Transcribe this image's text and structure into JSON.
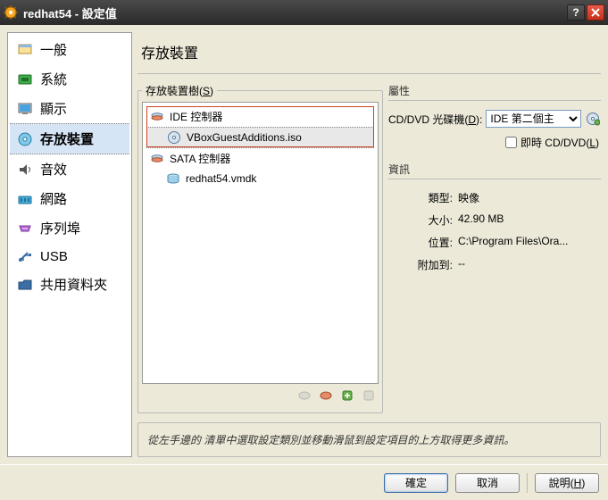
{
  "window": {
    "title": "redhat54 - 設定值"
  },
  "sidebar": {
    "items": [
      {
        "label": "一般",
        "icon": "general"
      },
      {
        "label": "系統",
        "icon": "system"
      },
      {
        "label": "顯示",
        "icon": "display"
      },
      {
        "label": "存放裝置",
        "icon": "storage",
        "selected": true
      },
      {
        "label": "音效",
        "icon": "audio"
      },
      {
        "label": "網路",
        "icon": "network"
      },
      {
        "label": "序列埠",
        "icon": "serial"
      },
      {
        "label": "USB",
        "icon": "usb"
      },
      {
        "label": "共用資料夾",
        "icon": "shared"
      }
    ]
  },
  "main": {
    "title": "存放裝置"
  },
  "tree": {
    "legend": "存放裝置樹",
    "legend_accel": "S",
    "items": [
      {
        "label": "IDE 控制器",
        "icon": "ide-controller",
        "level": 0
      },
      {
        "label": "VBoxGuestAdditions.iso",
        "icon": "cd",
        "level": 1,
        "selected": true
      },
      {
        "label": "SATA 控制器",
        "icon": "sata-controller",
        "level": 0
      },
      {
        "label": "redhat54.vmdk",
        "icon": "hdd",
        "level": 1
      }
    ]
  },
  "attrs": {
    "head": "屬性",
    "drive_label": "CD/DVD 光碟機",
    "drive_accel": "D",
    "drive_value": "IDE 第二個主",
    "live_label": "即時 CD/DVD",
    "live_accel": "L"
  },
  "info": {
    "head": "資訊",
    "rows": [
      {
        "label": "類型:",
        "value": "映像"
      },
      {
        "label": "大小:",
        "value": "42.90 MB"
      },
      {
        "label": "位置:",
        "value": "C:\\Program Files\\Ora..."
      },
      {
        "label": "附加到:",
        "value": "--"
      }
    ]
  },
  "hint": "從左手邊的 清單中選取設定類別並移動滑鼠到設定項目的上方取得更多資訊。",
  "buttons": {
    "ok": "確定",
    "cancel": "取消",
    "help": "說明",
    "help_accel": "H"
  }
}
